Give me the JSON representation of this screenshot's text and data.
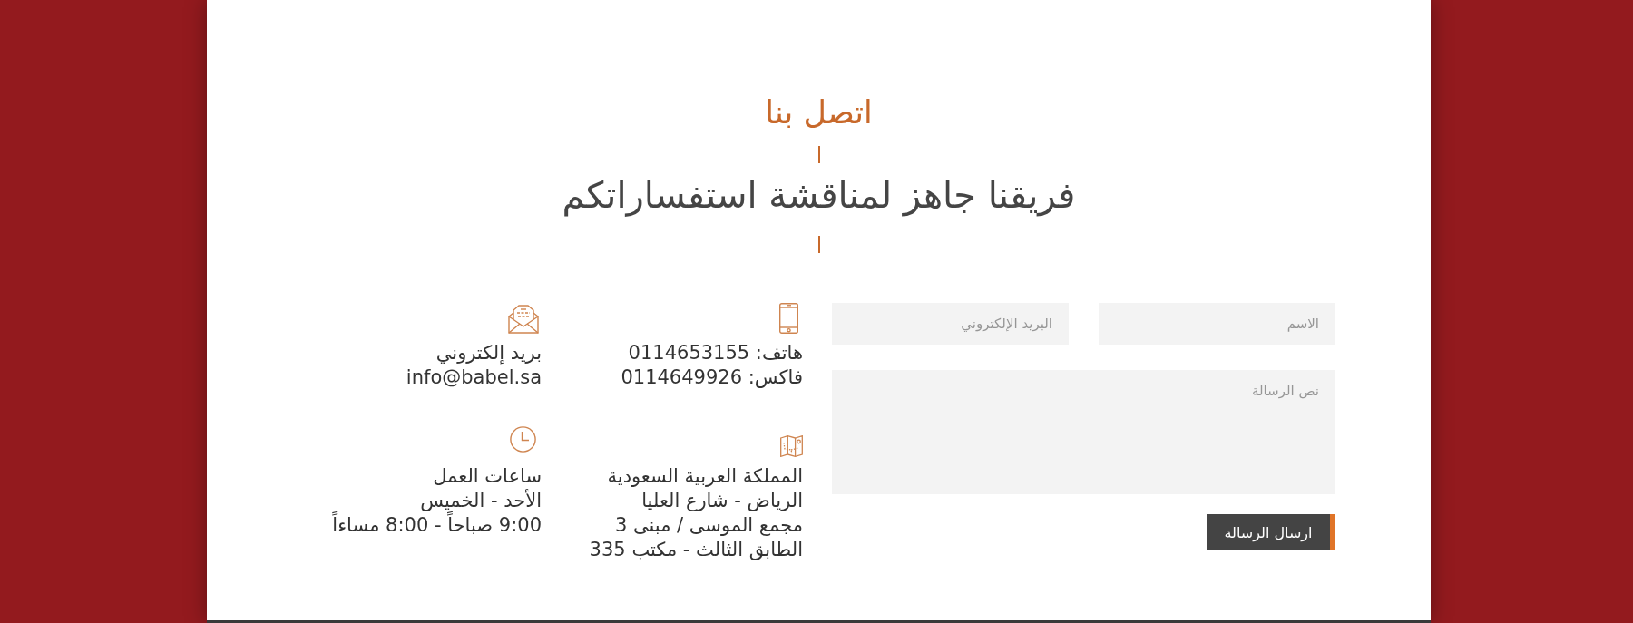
{
  "heading": {
    "title": "اتصل بنا",
    "subtitle": "فريقنا جاهز لمناقشة استفساراتكم"
  },
  "contact_info": [
    {
      "kind": "phone",
      "lines": [
        "هاتف: 0114653155",
        "فاكس: 0114649926"
      ]
    },
    {
      "kind": "email",
      "lines": [
        "بريد إلكتروني",
        "info@babel.sa"
      ]
    },
    {
      "kind": "address",
      "lines": [
        "المملكة العربية السعودية",
        "الرياض - شارع العليا",
        "مجمع الموسى / مبنى 3",
        "الطابق الثالث - مكتب 335"
      ]
    },
    {
      "kind": "hours",
      "lines": [
        "ساعات العمل",
        "الأحد - الخميس",
        "9:00 صباحاً - 8:00 مساءاً"
      ]
    }
  ],
  "contact_form": {
    "fields": [
      {
        "kind": "input",
        "placeholder": "الاسم"
      },
      {
        "kind": "input",
        "placeholder": "البريد الإلكتروني"
      },
      {
        "kind": "textarea",
        "placeholder": "نص الرسالة"
      }
    ],
    "submit_button": "ارسال الرسالة"
  }
}
